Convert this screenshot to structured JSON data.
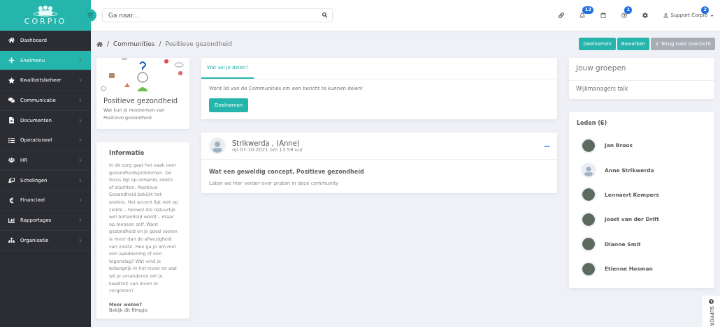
{
  "logo": {
    "text": "CORPIO"
  },
  "search": {
    "placeholder": "Ga naar..."
  },
  "topbar": {
    "icons": [
      {
        "kind": "link"
      },
      {
        "kind": "bell",
        "badge": "12"
      },
      {
        "kind": "calendar"
      },
      {
        "kind": "help",
        "badge": "1"
      },
      {
        "kind": "settings"
      }
    ],
    "user": {
      "name": "Support Corpio",
      "badge": "2"
    }
  },
  "sidebar": {
    "items": [
      {
        "label": "Dashboard",
        "selected": false,
        "expandable": false
      },
      {
        "label": "Snelmenu",
        "selected": true,
        "expandable": true
      },
      {
        "label": "Kwaliteitsbeheer",
        "selected": false,
        "expandable": true
      },
      {
        "label": "Communicatie",
        "selected": false,
        "expandable": true
      },
      {
        "label": "Documenten",
        "selected": false,
        "expandable": true
      },
      {
        "label": "Operationeel",
        "selected": false,
        "expandable": true
      },
      {
        "label": "HR",
        "selected": false,
        "expandable": true
      },
      {
        "label": "Scholingen",
        "selected": false,
        "expandable": true
      },
      {
        "label": "Financieel",
        "selected": false,
        "expandable": true
      },
      {
        "label": "Rapportages",
        "selected": false,
        "expandable": true
      },
      {
        "label": "Organisatie",
        "selected": false,
        "expandable": true
      }
    ]
  },
  "breadcrumb": {
    "separator": "/",
    "items": [
      "Communities",
      "Positieve gezondheid"
    ]
  },
  "actions": [
    {
      "label": "Deelnemen",
      "disabled": false
    },
    {
      "label": "Bewerken",
      "disabled": false
    },
    {
      "label": "Terug naar overzicht",
      "disabled": true
    }
  ],
  "community": {
    "title": "Positieve gezondheid",
    "subtitle": "Wat kun je meenemen van Positieve gezondheid"
  },
  "info": {
    "title": "Informatie",
    "text": "In de zorg gaat het vaak over gezondheidsproblemen. De focus ligt op iemands ziekte of klachten. Positieve Gezondheid bekijkt het anders. Het accent ligt niet op ziekte – hoewel die natuurlijk wel behandeld wordt – maar op mensen zelf. Want gezondheid en je goed voelen is meer dan de afwezigheid van ziekte. Hoe ga je om met een aandoening of een tegenslag? Wat vind je belangrijk in het leven en wat wil je veranderen om je kwaliteit van leven te vergroten?",
    "more_title": "Meer weten?",
    "more_text": "Bekijk dit filmpje."
  },
  "share": {
    "tabs": [
      {
        "label": "Wat wil je delen?",
        "selected": true
      }
    ],
    "message": "Word lid van de Communities om een bericht te kunnen delen!",
    "button": "Deelnemen"
  },
  "post": {
    "author": "Strikwerda , (Anne)",
    "date": "op 07-10-2021 om 13:59 uur",
    "menu": "•••",
    "title": "Wat een geweldig concept, Positieve gezondheid",
    "body": "Laten we hier verder over praten in deze community"
  },
  "groups": {
    "title": "Jouw groepen",
    "items": [
      "Wijkmanagers talk"
    ]
  },
  "members": {
    "title": "Leden (6)",
    "items": [
      {
        "name": "Jan Broos",
        "kind": "photo"
      },
      {
        "name": "Anne Strikwerda",
        "kind": "default"
      },
      {
        "name": "Lennaert Kempers",
        "kind": "photo"
      },
      {
        "name": "Joost van der Drift",
        "kind": "photo"
      },
      {
        "name": "Dianne Smit",
        "kind": "photo"
      },
      {
        "name": "Etienne Hosman",
        "kind": "photo"
      }
    ]
  },
  "support_tab": {
    "label": "SUPPOR"
  }
}
